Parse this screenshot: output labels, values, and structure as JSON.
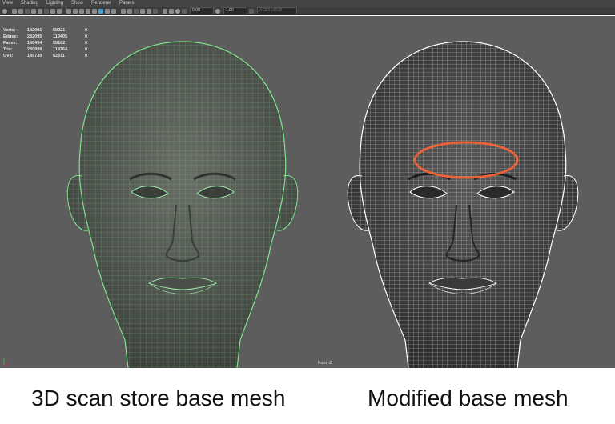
{
  "menu": [
    "View",
    "Shading",
    "Lighting",
    "Show",
    "Renderer",
    "Panels"
  ],
  "toolbar": {
    "near_value": "0.00",
    "far_value": "1.00",
    "color_space": "ACES sRGB"
  },
  "stats": {
    "rows": [
      {
        "label": "Verts:",
        "v1": "142091",
        "v2": "59221",
        "v3": "0"
      },
      {
        "label": "Edges:",
        "v1": "282095",
        "v2": "118405",
        "v3": "0"
      },
      {
        "label": "Faces:",
        "v1": "140454",
        "v2": "59182",
        "v3": "0"
      },
      {
        "label": "Tris:",
        "v1": "280908",
        "v2": "118364",
        "v3": "0"
      },
      {
        "label": "UVs:",
        "v1": "149730",
        "v2": "62611",
        "v3": "0"
      }
    ]
  },
  "viewport": {
    "camera": "front -Z",
    "background": "#5d5d5d"
  },
  "meshes": {
    "left_wire_color": "#7ee38e",
    "right_wire_color": "#ffffff",
    "highlight_color": "#e8623a"
  },
  "captions": {
    "left": "3D scan store base mesh",
    "right": "Modified base mesh"
  }
}
